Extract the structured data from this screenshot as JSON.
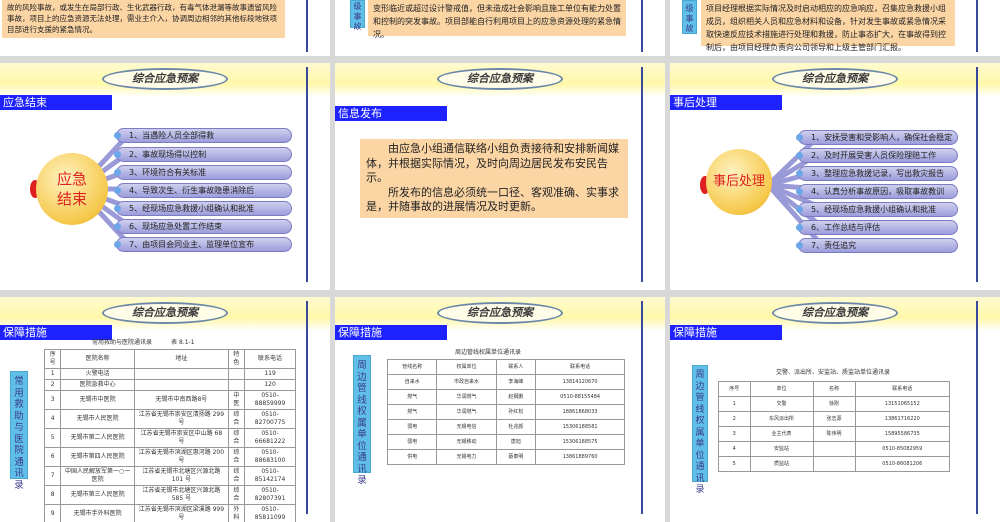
{
  "top": {
    "left_text": "故的风险事故，或发生在局部行政、生化武器行政，有毒气体泄漏等故事遗留风险事故，项目上的应急资源无法处理，需业主介入，协调周边相邻的其他标段地铁项目部进行支援的紧急情况。",
    "mid_vlabel": "级 事 故",
    "mid_text": "变形临近或超过设计警戒值，但未造成社会影响且施工单位有能力处置和控制的突发事故。项目部能自行利用项目上的应急资源处理的紧急情况。",
    "right_vlabel": "级 事 故",
    "right_text": "项目经理根据实际情况及时启动相应的应急响应，召集应急救援小组成员，组织相关人员和应急材料和设备，针对发生事故或紧急情况采取快速反应技术措施进行处理和救援，防止事态扩大，在事故得到控制后，由项目经理负责向公司领导和上级主管部门汇报。"
  },
  "banner_title": "综合应急预案",
  "slide_end": {
    "title": "应急结束",
    "center": "应急结束",
    "items": [
      "1、当遇险人员全部得救",
      "2、事故现场得以控制",
      "3、环境符合有关标准",
      "4、导致次生、衍生事故隐患消除后",
      "5、经现场应急救援小组确认和批准",
      "6、现场应急处置工作结束",
      "7、由项目会同业主、监理单位宣布"
    ]
  },
  "slide_info": {
    "title": "信息发布",
    "p1": "由应急小组通信联络小组负责接待和安排新闻媒体，并根据实际情况，及时向周边居民发布安民告示。",
    "p2": "所发布的信息必须统一口径、客观准确、实事求是，并随事故的进展情况及时更新。"
  },
  "slide_after": {
    "title": "事后处理",
    "center": "事后处理",
    "items": [
      "1、安抚受害和受影响人，确保社会稳定",
      "2、及时开展受害人员保险理赔工作",
      "3、整理应急救援记录，写出救灾报告",
      "4、认真分析事故原因，吸取事故教训",
      "5、经现场应急救援小组确认和批准",
      "6、工作总结与评估",
      "7、责任追究"
    ]
  },
  "slide_hosp": {
    "title": "保障措施",
    "vlabel": "常用救助与医院通讯录",
    "caption": "常用救助与医院通讯录",
    "table_no": "表 8.1-1",
    "headers": [
      "序号",
      "医院名称",
      "地址",
      "特色",
      "联系电话"
    ],
    "rows": [
      [
        "1",
        "火警电话",
        "",
        "",
        "119"
      ],
      [
        "2",
        "医院急救中心",
        "",
        "",
        "120"
      ],
      [
        "3",
        "无锡市中医院",
        "无锡市中南西路8号",
        "中医",
        "0510-88859999"
      ],
      [
        "4",
        "无锡市人民医院",
        "江苏省无锡市崇安区清扬路 299 号",
        "综合",
        "0510-82700775"
      ],
      [
        "5",
        "无锡市第二人民医院",
        "江苏省无锡市崇安区中山路 68 号",
        "综合",
        "0510-66681222"
      ],
      [
        "6",
        "无锡市第四人民医院",
        "江苏省无锡市滨湖区惠河路 200号",
        "综合",
        "0510-88683100"
      ],
      [
        "7",
        "中国人民解放军第一○一医院",
        "江苏省无锡市北塘区兴源北路 101 号",
        "综合",
        "0510-85142174"
      ],
      [
        "8",
        "无锡市第三人民医院",
        "江苏省无锡市北塘区兴源北路 585 号",
        "综合",
        "0510-82807391"
      ],
      [
        "9",
        "无锡市手外科医院",
        "江苏省无锡市滨湖区梁溪路 999 号",
        "外科",
        "0510-85811099"
      ]
    ]
  },
  "slide_pipe": {
    "title": "保障措施",
    "vlabel": "周边管线权属单位通讯录",
    "caption": "周边管线权属单位通讯录",
    "headers": [
      "管线名称",
      "权属单位",
      "联系人",
      "联系电话"
    ],
    "rows": [
      [
        "自来水",
        "市政自来水",
        "李海峰",
        "13814120670"
      ],
      [
        "燃气",
        "华润燃气",
        "赵钢鹏",
        "0510-88155484"
      ],
      [
        "燃气",
        "华润燃气",
        "孙红松",
        "18861868033"
      ],
      [
        "弱电",
        "无锡电信",
        "杜兆颜",
        "15306188581"
      ],
      [
        "弱电",
        "无锡移动",
        "唐旭",
        "15306188575"
      ],
      [
        "供电",
        "无锡电力",
        "蔡泰明",
        "13861889760"
      ]
    ]
  },
  "slide_police": {
    "title": "保障措施",
    "vlabel": "周边管线权属单位通讯录",
    "caption": "交警、派出所、安监站、质监站单位通讯录",
    "headers": [
      "序号",
      "单位",
      "名称",
      "联系电话"
    ],
    "rows": [
      [
        "1",
        "交警",
        "徐刚",
        "13151065152"
      ],
      [
        "2",
        "东风派出所",
        "张志源",
        "13861716220"
      ],
      [
        "3",
        "业主代表",
        "陈伟明",
        "15895586735"
      ],
      [
        "4",
        "安监站",
        "",
        "0510-85082959"
      ],
      [
        "5",
        "质监站",
        "",
        "0510-86081206"
      ]
    ]
  }
}
